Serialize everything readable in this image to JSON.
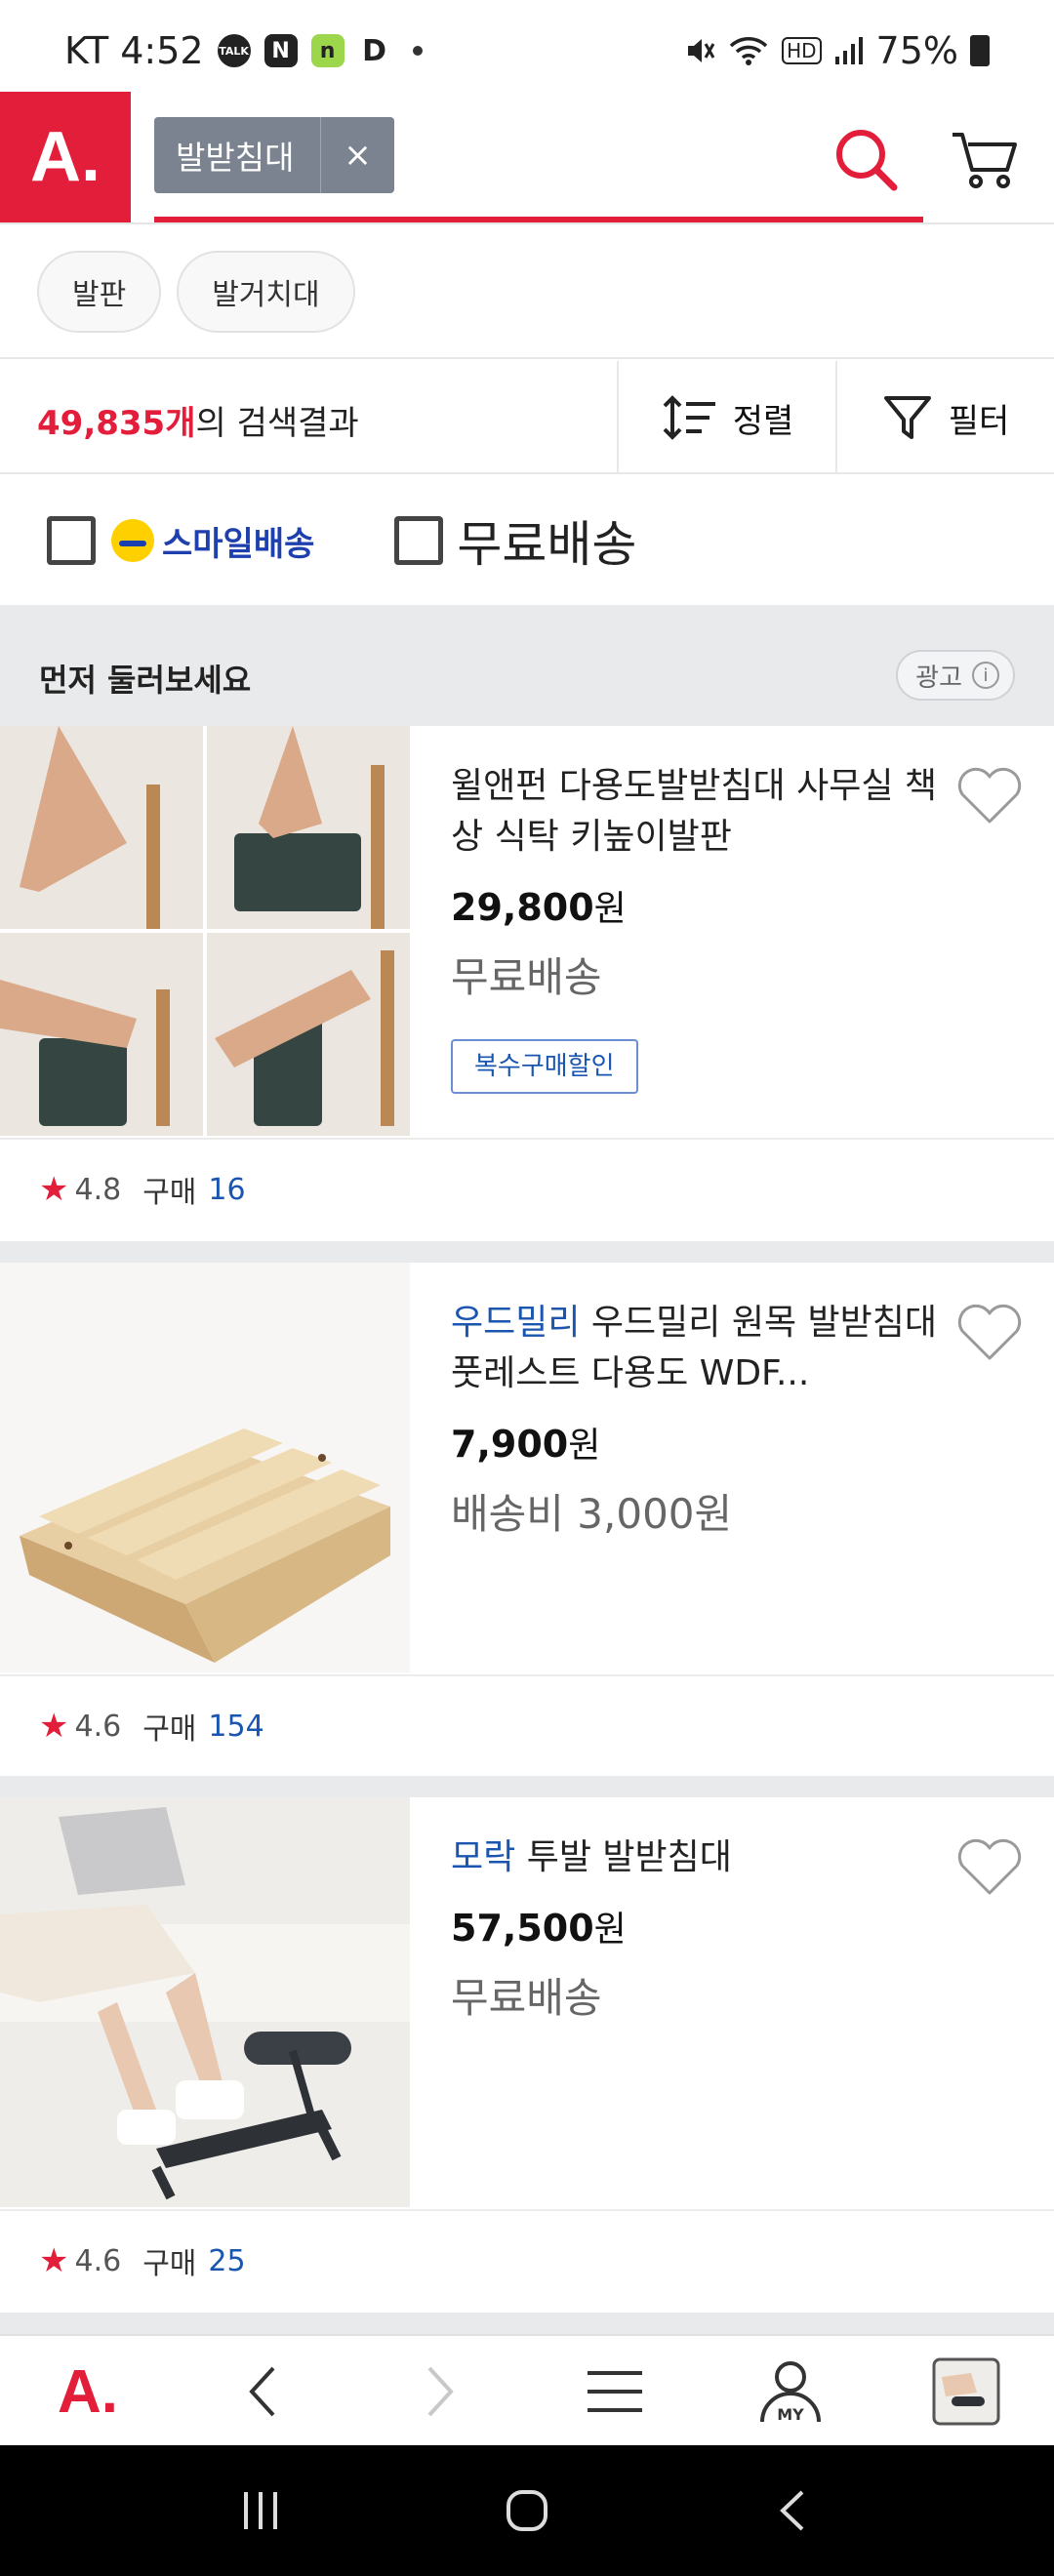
{
  "status_bar": {
    "carrier_time": "KT 4:52",
    "battery": "75%",
    "icons": [
      "talk-icon",
      "naver-icon",
      "band-icon",
      "d-icon",
      "mute-icon",
      "wifi-icon",
      "hd-icon",
      "signal-icon",
      "battery-icon"
    ]
  },
  "header": {
    "logo": "A.",
    "query_chip": "발받침대",
    "clear_icon": "×",
    "accent": "#e31e3a"
  },
  "related_keywords": [
    "발판",
    "발거치대"
  ],
  "results": {
    "count": "49,835개",
    "count_suffix": "의 검색결과",
    "sort_label": "정렬",
    "filter_label": "필터"
  },
  "filters": {
    "smile_delivery": "스마일배송",
    "free_shipping": "무료배송"
  },
  "ad_section": {
    "title": "먼저 둘러보세요",
    "ad_label": "광고",
    "info_icon": "i"
  },
  "products": [
    {
      "brand": "",
      "title": "윌앤펀 다용도발받침대 사무실 책상 식탁 키높이발판",
      "price": "29,800",
      "won": "원",
      "shipping": "무료배송",
      "coupon": "복수구매할인",
      "rating": "4.8",
      "buy_label": "구매",
      "buy_count": "16"
    },
    {
      "brand": "우드밀리",
      "title": " 우드밀리 원목 발받침대 풋레스트 다용도 WDF...",
      "price": "7,900",
      "won": "원",
      "shipping": "배송비 3,000원",
      "rating": "4.6",
      "buy_label": "구매",
      "buy_count": "154"
    },
    {
      "brand": "모락",
      "title": " 투발 발받침대",
      "price": "57,500",
      "won": "원",
      "shipping": "무료배송",
      "rating": "4.6",
      "buy_label": "구매",
      "buy_count": "25"
    }
  ],
  "bottom_nav": {
    "logo": "A.",
    "items": [
      "back-icon",
      "forward-icon",
      "menu-icon",
      "my-icon",
      "recent-product-icon"
    ],
    "my_label": "MY"
  },
  "system_nav": [
    "recents-icon",
    "home-icon",
    "back-icon"
  ]
}
